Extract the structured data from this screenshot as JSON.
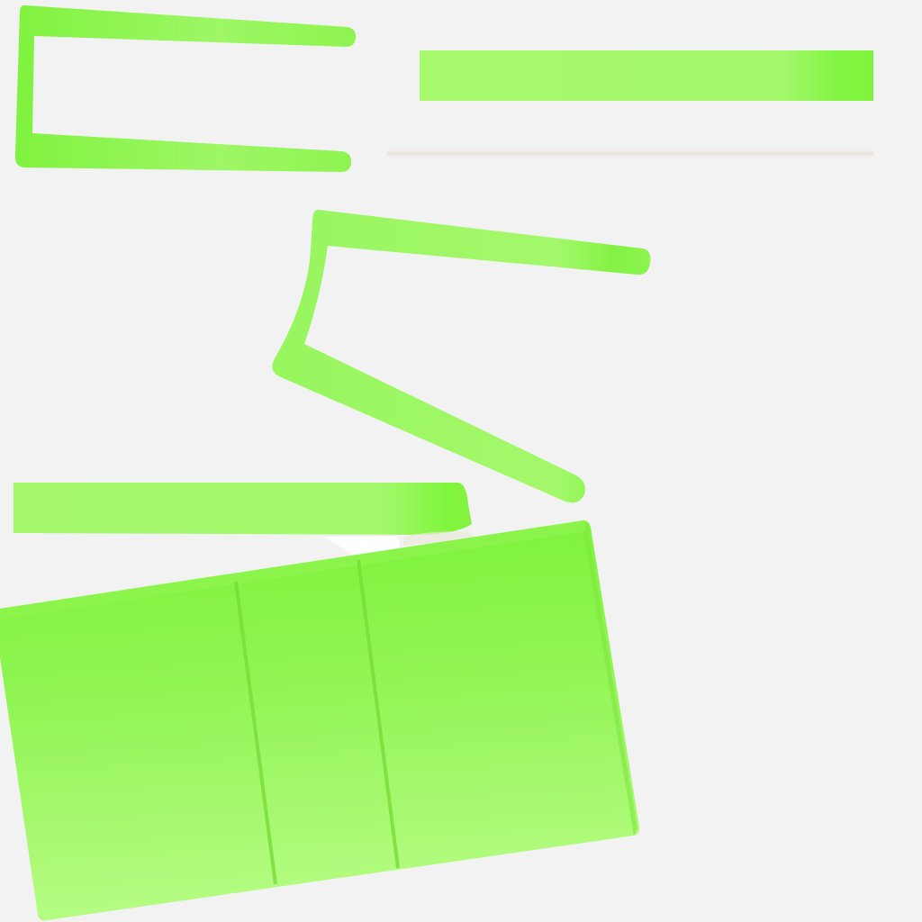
{
  "palette": {
    "background": "#f2f2f2",
    "green_bright": "#7ff53e",
    "green_mid": "#9ef866",
    "green_light": "#b8fd86",
    "crease": "#79dd3c"
  }
}
